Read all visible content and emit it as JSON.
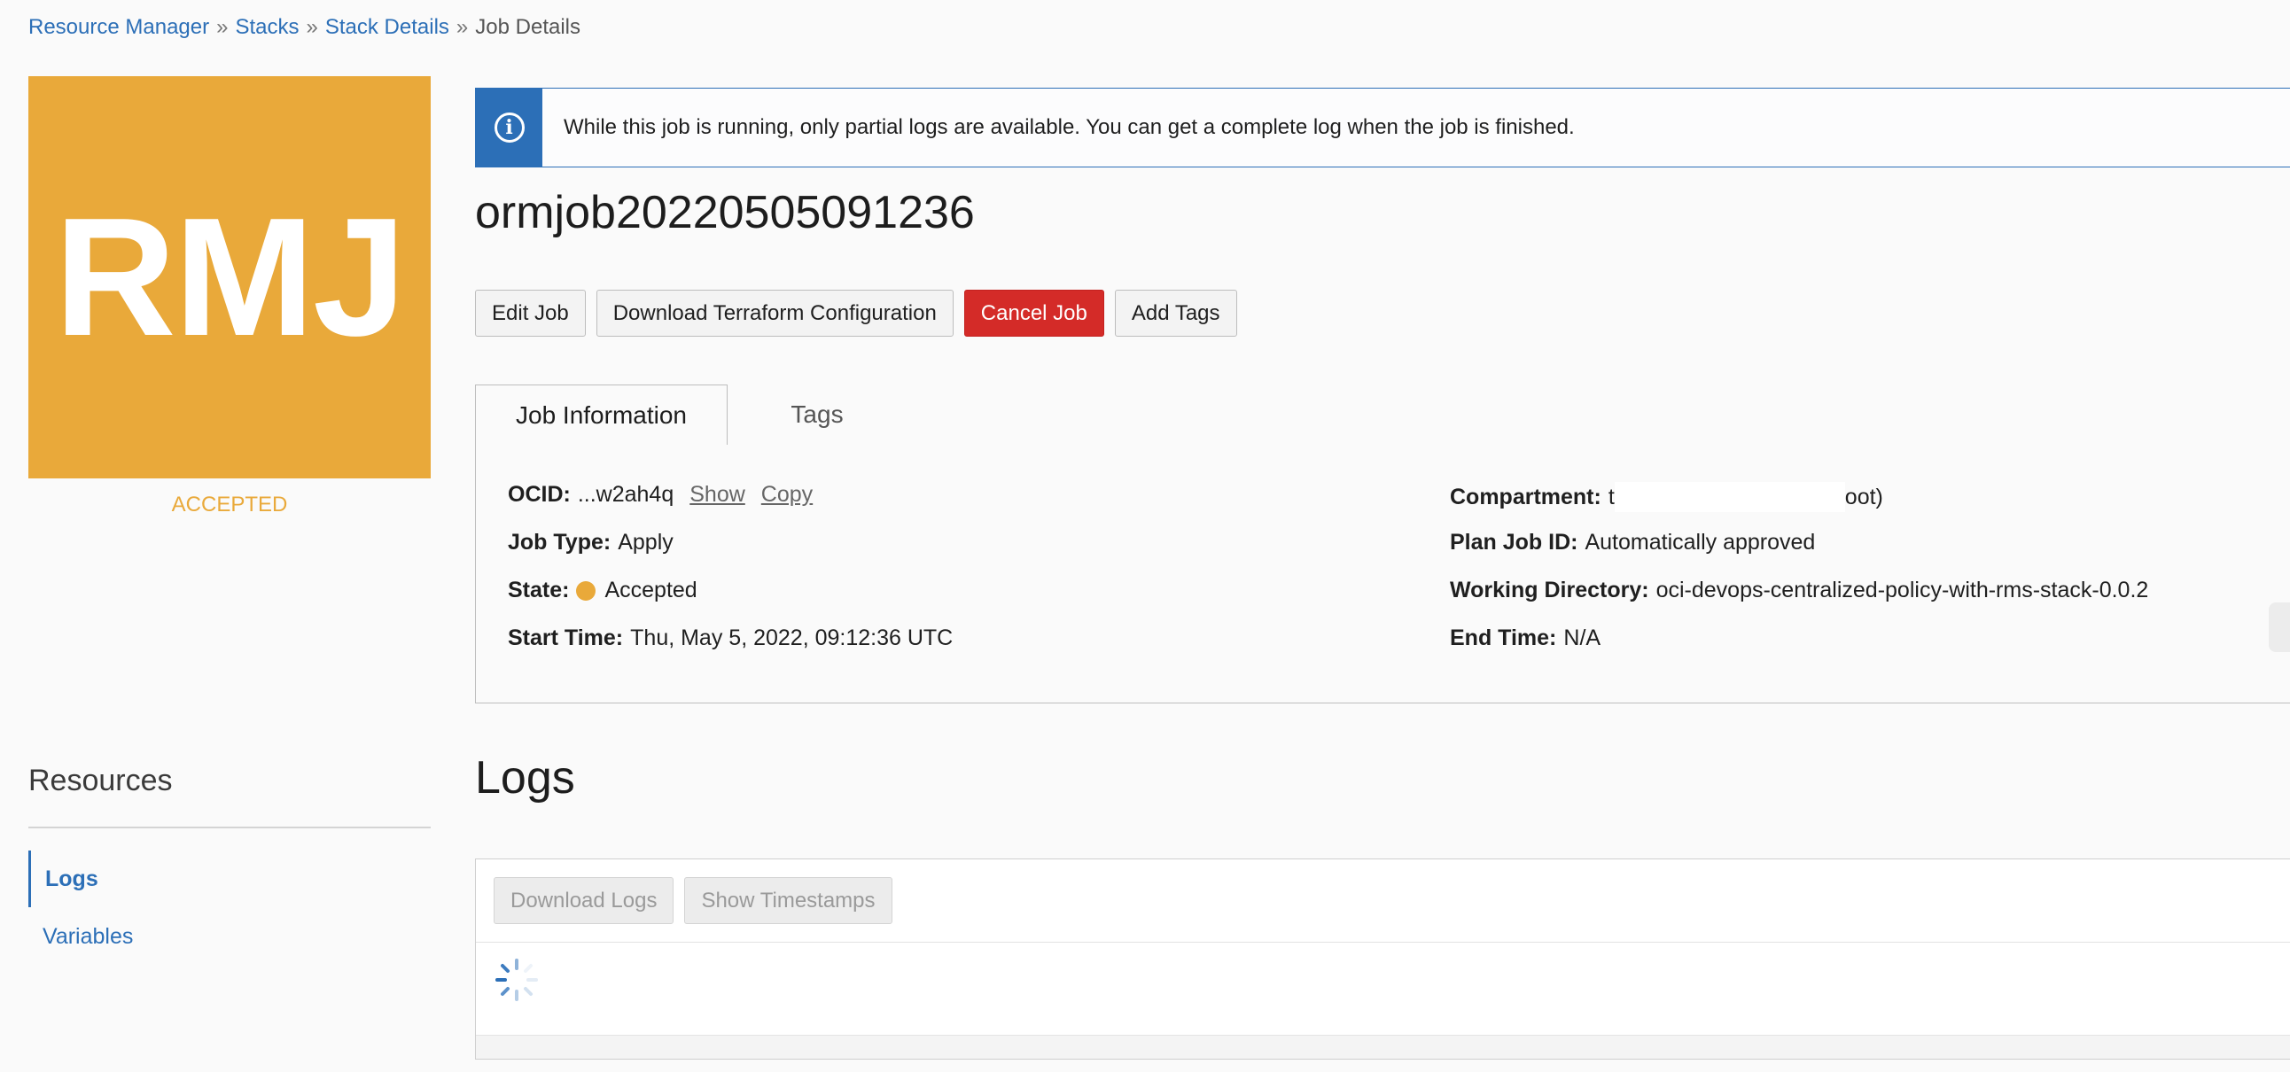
{
  "breadcrumb": {
    "items": [
      "Resource Manager",
      "Stacks",
      "Stack Details"
    ],
    "separator": "»",
    "current": "Job Details"
  },
  "logo": {
    "initials": "RMJ",
    "color": "#e9a93a"
  },
  "status": "ACCEPTED",
  "banner": {
    "icon": "info-icon",
    "text": "While this job is running, only partial logs are available. You can get a complete log when the job is finished."
  },
  "job": {
    "name": "ormjob20220505091236"
  },
  "actions": {
    "edit": "Edit Job",
    "download_tf": "Download Terraform Configuration",
    "cancel": "Cancel Job",
    "add_tags": "Add Tags"
  },
  "tabs": {
    "job_information": "Job Information",
    "tags": "Tags"
  },
  "info": {
    "ocid_label": "OCID:",
    "ocid_value": "...w2ah4q",
    "show": "Show",
    "copy": "Copy",
    "job_type_label": "Job Type:",
    "job_type_value": "Apply",
    "state_label": "State:",
    "state_value": "Accepted",
    "state_color": "#e9a93a",
    "start_time_label": "Start Time:",
    "start_time_value": "Thu, May 5, 2022, 09:12:36 UTC",
    "compartment_label": "Compartment:",
    "compartment_prefix": "t",
    "compartment_suffix": "oot)",
    "plan_job_label": "Plan Job ID:",
    "plan_job_value": "Automatically approved",
    "working_dir_label": "Working Directory:",
    "working_dir_value": "oci-devops-centralized-policy-with-rms-stack-0.0.2",
    "end_time_label": "End Time:",
    "end_time_value": "N/A"
  },
  "resources": {
    "title": "Resources",
    "items": [
      "Logs",
      "Variables"
    ]
  },
  "logs": {
    "title": "Logs",
    "download": "Download Logs",
    "timestamps": "Show Timestamps"
  }
}
